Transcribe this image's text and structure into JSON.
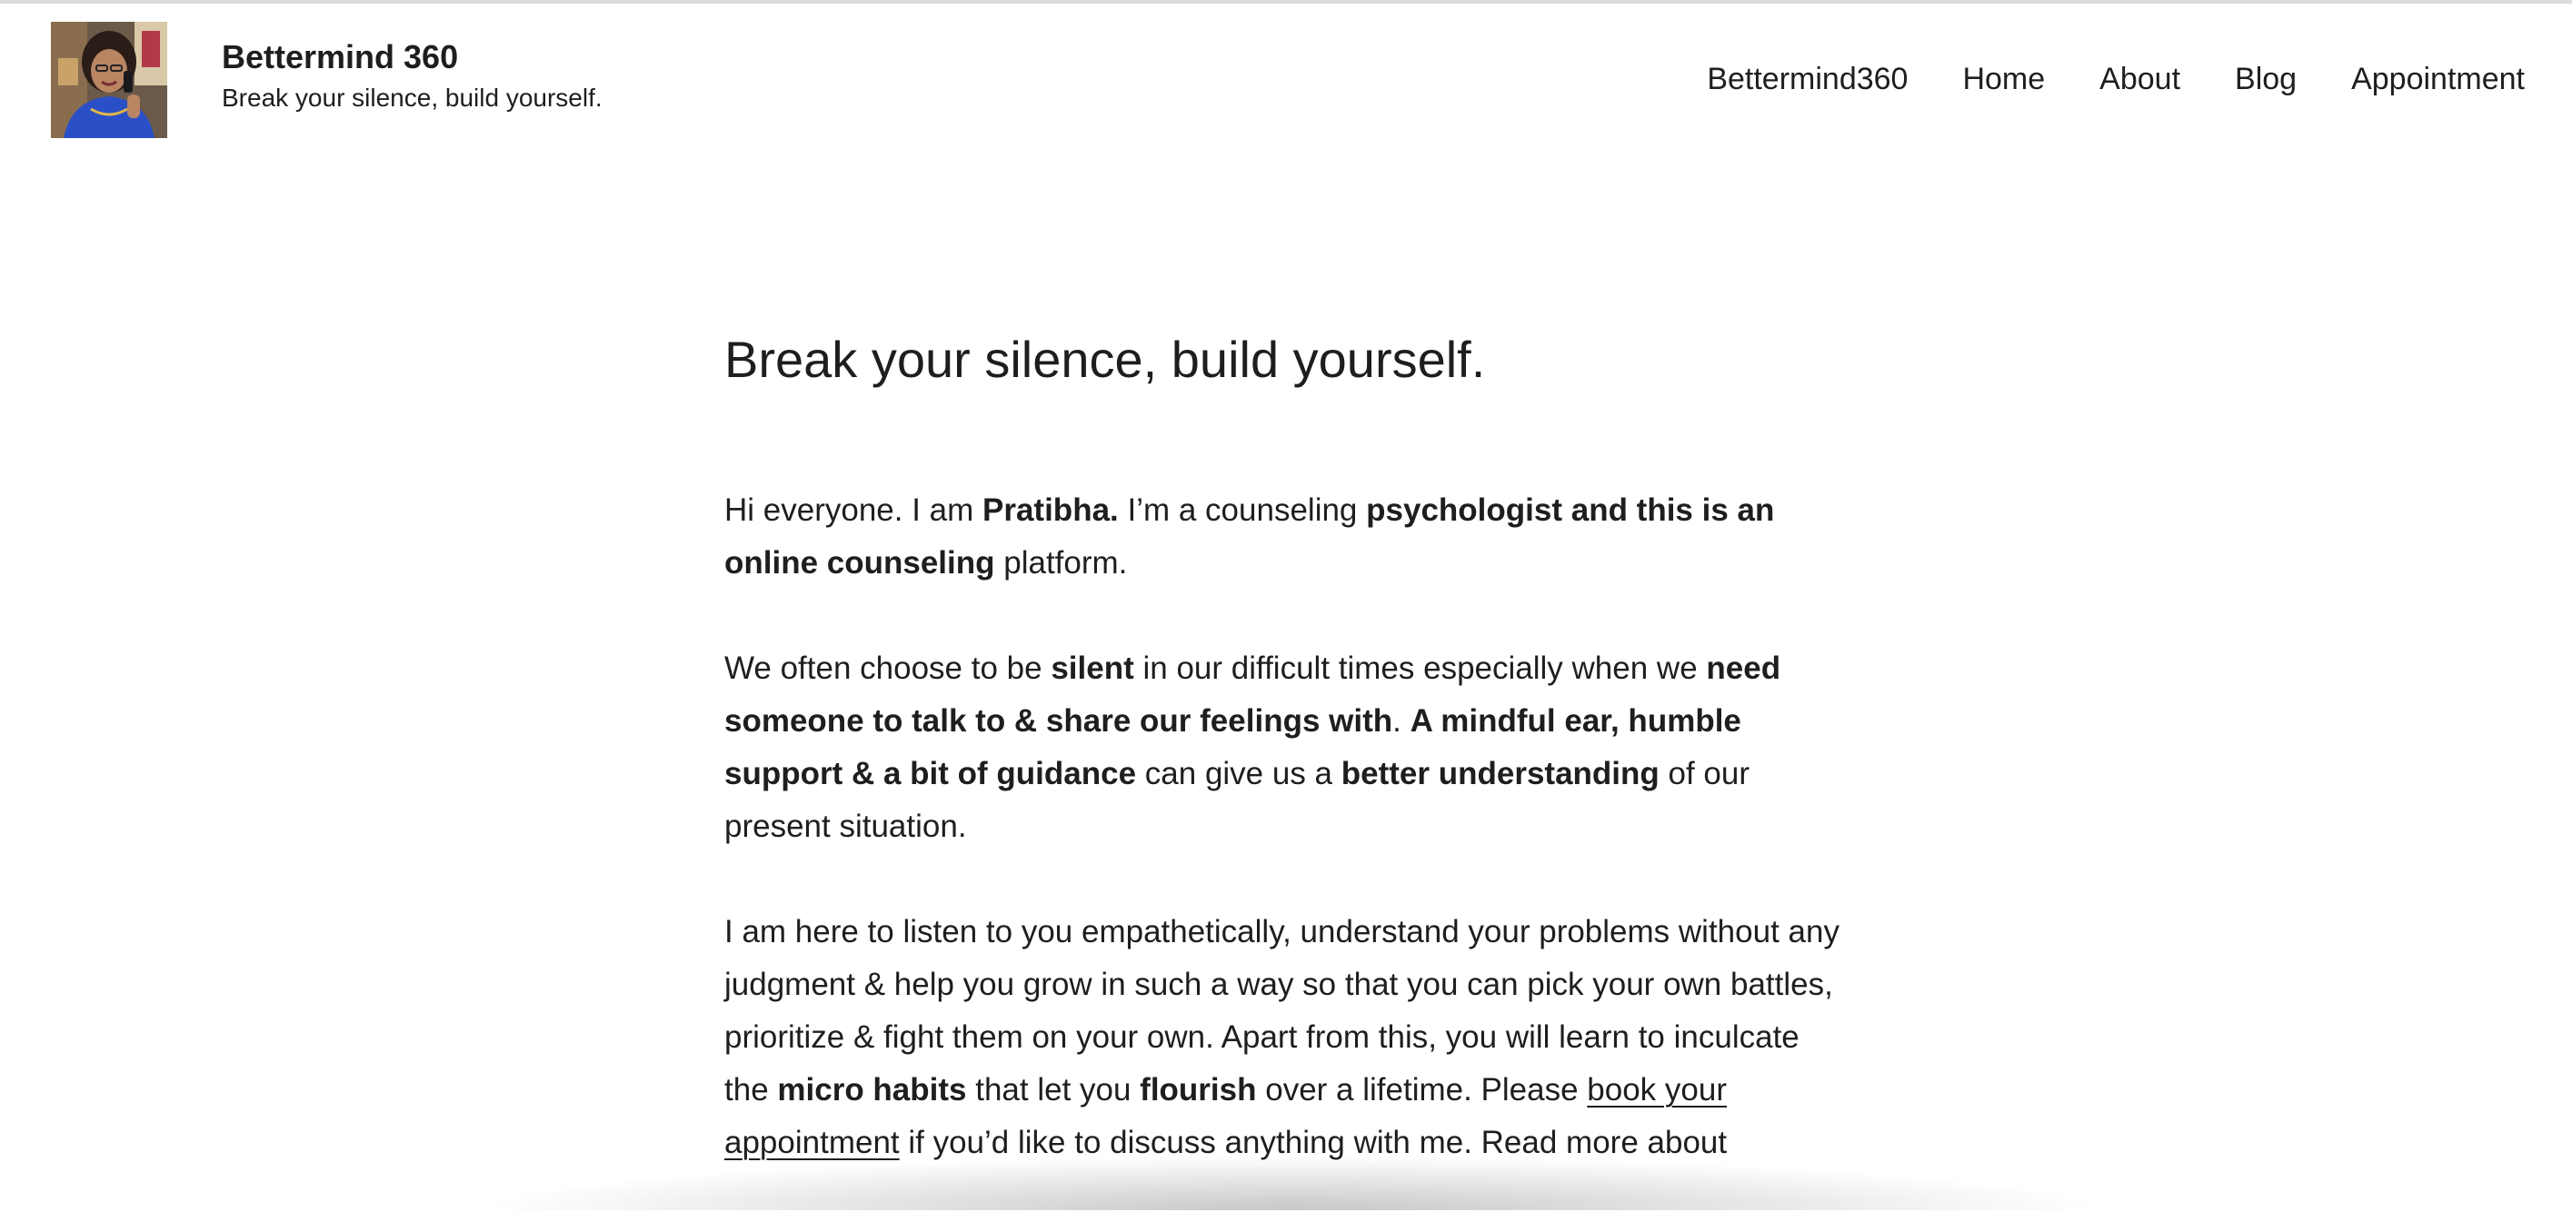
{
  "header": {
    "logo_alt": "Bettermind 360",
    "site_title": "Bettermind 360",
    "tagline": "Break your silence, build yourself."
  },
  "nav": {
    "items": [
      {
        "label": "Bettermind360"
      },
      {
        "label": "Home"
      },
      {
        "label": "About"
      },
      {
        "label": "Blog"
      },
      {
        "label": "Appointment"
      }
    ]
  },
  "main": {
    "title": "Break your silence, build yourself.",
    "p1": {
      "t1": "Hi everyone. I am ",
      "b1": "Pratibha.",
      "t2": " I’m a counseling ",
      "b2": "psychologist and this is an online counseling",
      "t3": " platform."
    },
    "p2": {
      "t1": "We often choose to be ",
      "b1": "silent",
      "t2": " in our difficult times especially when we ",
      "b2": "need someone to talk to & share our feelings with",
      "t3": ". ",
      "b3": "A mindful ear, humble support & a bit of guidance",
      "t4": " can give us a ",
      "b4": "better understanding",
      "t5": " of our present situation."
    },
    "p3": {
      "t1": "I am here to listen to you empathetically, understand your problems without any judgment & help you grow in such a way so that you can pick your own battles, prioritize & fight them on your own. Apart from this, you will learn to inculcate the ",
      "b1": "micro habits",
      "t2": " that let you ",
      "b2": "flourish",
      "t3": " over a lifetime. Please ",
      "link": "book your appointment",
      "t4": " if you’d like to discuss anything with me. Read more about"
    }
  },
  "colors": {
    "text": "#1e1e1e",
    "background": "#ffffff"
  }
}
